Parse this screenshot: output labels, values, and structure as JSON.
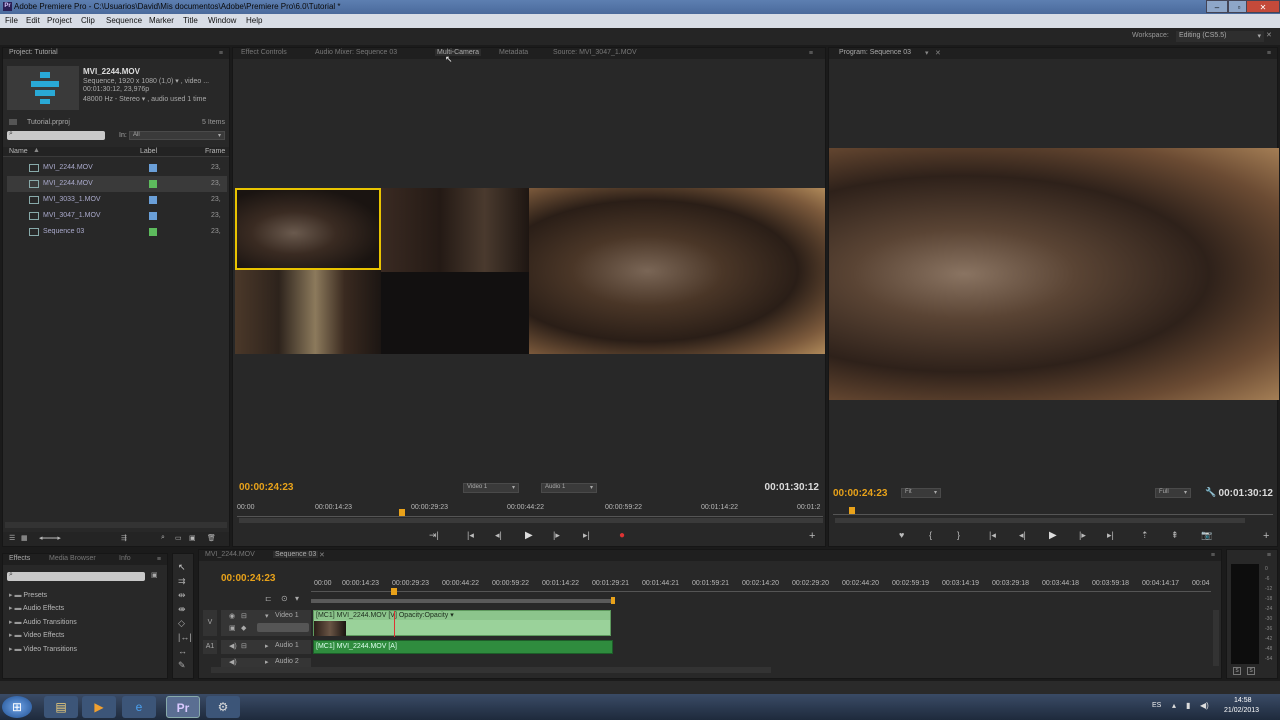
{
  "window": {
    "title": "Adobe Premiere Pro - C:\\Usuarios\\David\\Mis documentos\\Adobe\\Premiere Pro\\6.0\\Tutorial *",
    "app_badge": "Pr"
  },
  "menu": [
    "File",
    "Edit",
    "Project",
    "Clip",
    "Sequence",
    "Marker",
    "Title",
    "Window",
    "Help"
  ],
  "workspace": {
    "label": "Workspace:",
    "value": "Editing (CS5.5)"
  },
  "project": {
    "tab": "Project: Tutorial",
    "clip_name": "MVI_2244.MOV",
    "clip_info_1": "Sequence, 1920 x 1080 (1,0)  ▾ , video ...",
    "clip_info_2": "00:01:30:12, 23,976p",
    "clip_info_3": "48000 Hz - Stereo  ▾ , audio used 1 time",
    "file": "Tutorial.prproj",
    "items_count": "5 Items",
    "in_label": "In:",
    "in_value": "All",
    "col_name": "Name",
    "col_label": "Label",
    "col_frame": "Frame",
    "items": [
      {
        "name": "MVI_2244.MOV",
        "color": "#6a9fd8",
        "frame": "23,"
      },
      {
        "name": "MVI_2244.MOV",
        "color": "#5dbb5d",
        "frame": "23,"
      },
      {
        "name": "MVI_3033_1.MOV",
        "color": "#6a9fd8",
        "frame": "23,"
      },
      {
        "name": "MVI_3047_1.MOV",
        "color": "#6a9fd8",
        "frame": "23,"
      },
      {
        "name": "Sequence 03",
        "color": "#5dbb5d",
        "frame": "23,"
      }
    ]
  },
  "source_tabs": [
    "Effect Controls",
    "Audio Mixer: Sequence 03",
    "Multi-Camera",
    "Metadata",
    "Source: MVI_3047_1.MOV"
  ],
  "multicam": {
    "tc_left": "00:00:24:23",
    "tc_right": "00:01:30:12",
    "video_dd": "Video 1",
    "audio_dd": "Audio 1",
    "ruler": [
      "00:00",
      "00:00:14:23",
      "00:00:29:23",
      "00:00:44:22",
      "00:00:59:22",
      "00:01:14:22",
      "00:01:2"
    ]
  },
  "program": {
    "tab": "Program: Sequence 03",
    "tc_left": "00:00:24:23",
    "tc_right": "00:01:30:12",
    "fit": "Fit",
    "full": "Full"
  },
  "effects": {
    "tabs": [
      "Effects",
      "Media Browser",
      "Info"
    ],
    "folders": [
      "Presets",
      "Audio Effects",
      "Audio Transitions",
      "Video Effects",
      "Video Transitions"
    ]
  },
  "timeline": {
    "tabs": [
      "MVI_2244.MOV",
      "Sequence 03"
    ],
    "tc": "00:00:24:23",
    "ruler": [
      "00:00",
      "00:00:14:23",
      "00:00:29:23",
      "00:00:44:22",
      "00:00:59:22",
      "00:01:14:22",
      "00:01:29:21",
      "00:01:44:21",
      "00:01:59:21",
      "00:02:14:20",
      "00:02:29:20",
      "00:02:44:20",
      "00:02:59:19",
      "00:03:14:19",
      "00:03:29:18",
      "00:03:44:18",
      "00:03:59:18",
      "00:04:14:17",
      "00:04"
    ],
    "v_label": "V",
    "video1": "Video 1",
    "a1_label": "A1",
    "audio1": "Audio 1",
    "audio2": "Audio 2",
    "video_clip": "[MC1] MVI_2244.MOV [V]  Opacity:Opacity ▾",
    "audio_clip": "[MC1] MVI_2244.MOV [A]"
  },
  "meter_scale": [
    "0",
    "-6",
    "-12",
    "-18",
    "-24",
    "-30",
    "-36",
    "-42",
    "-48",
    "-54"
  ],
  "taskbar": {
    "lang": "ES",
    "time": "14:58",
    "date": "21/02/2013"
  }
}
